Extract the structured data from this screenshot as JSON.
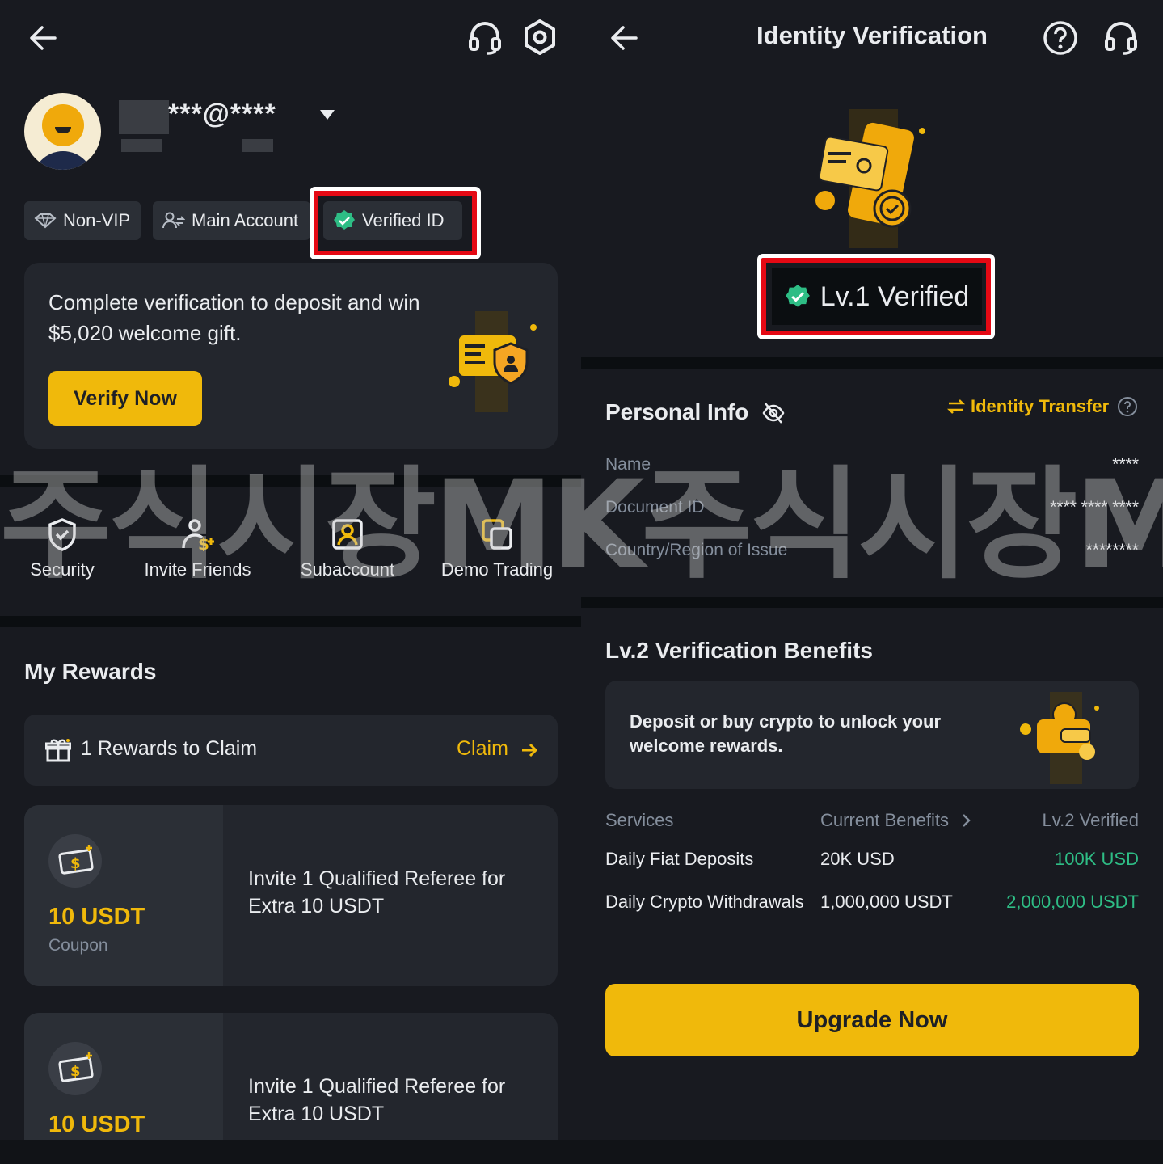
{
  "left": {
    "header": {
      "back_icon": "arrow-left-icon",
      "support_icon": "headset-icon",
      "settings_icon": "gear-icon"
    },
    "profile": {
      "email_masked": "***@****",
      "dropdown_icon": "caret-down-icon"
    },
    "chips": {
      "vip": "Non-VIP",
      "account": "Main Account",
      "verified": "Verified ID"
    },
    "promo": {
      "text": "Complete verification to deposit and win $5,020 welcome gift.",
      "button": "Verify Now"
    },
    "quick_actions": [
      {
        "label": "Security",
        "icon": "shield-check-icon"
      },
      {
        "label": "Invite Friends",
        "icon": "user-dollar-icon"
      },
      {
        "label": "Subaccount",
        "icon": "user-square-icon"
      },
      {
        "label": "Demo Trading",
        "icon": "copy-squares-icon"
      }
    ],
    "rewards": {
      "title": "My Rewards",
      "claim_row": {
        "text": "1 Rewards to Claim",
        "claim": "Claim"
      },
      "coupons": [
        {
          "amount": "10 USDT",
          "type": "Coupon",
          "description": "Invite 1 Qualified Referee for Extra 10 USDT"
        },
        {
          "amount": "10 USDT",
          "type": "",
          "description": "Invite 1 Qualified Referee for Extra 10 USDT"
        }
      ]
    }
  },
  "right": {
    "header": {
      "title": "Identity Verification",
      "back_icon": "arrow-left-icon",
      "help_icon": "question-circle-icon",
      "support_icon": "headset-icon"
    },
    "status": "Lv.1 Verified",
    "personal_info": {
      "title": "Personal Info",
      "transfer": "Identity Transfer",
      "rows": [
        {
          "label": "Name",
          "value": "****"
        },
        {
          "label": "Document ID",
          "value": "**** **** ****"
        },
        {
          "label": "Country/Region of Issue",
          "value": "********"
        }
      ]
    },
    "benefits": {
      "title": "Lv.2 Verification Benefits",
      "banner": "Deposit or buy crypto to unlock your welcome rewards.",
      "headers": {
        "services": "Services",
        "current": "Current Benefits",
        "next": "Lv.2 Verified"
      },
      "rows": [
        {
          "service": "Daily Fiat Deposits",
          "current": "20K USD",
          "next": "100K USD"
        },
        {
          "service": "Daily Crypto Withdrawals",
          "current": "1,000,000 USDT",
          "next": "2,000,000 USDT"
        }
      ],
      "button": "Upgrade Now"
    }
  },
  "watermark": "주식시장MK주식시장MK",
  "colors": {
    "background": "#181a20",
    "card": "#23262d",
    "accent": "#f0b90b",
    "green": "#2ebd85",
    "highlight": "#e50914"
  }
}
